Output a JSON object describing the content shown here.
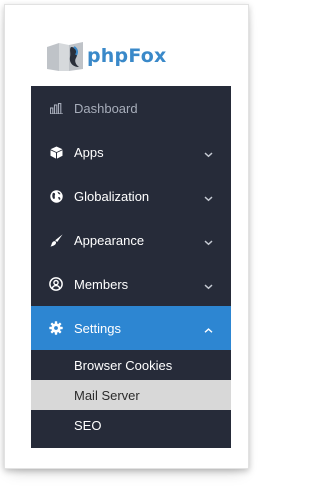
{
  "brand": {
    "name": "phpFox",
    "logo_icon": "phpfox-logo-icon"
  },
  "colors": {
    "sidebar_bg": "#262b39",
    "active_bg": "#2d86d2",
    "highlight_bg": "#d8d8d8",
    "brand_blue": "#3a89c9"
  },
  "menu": {
    "dashboard": {
      "label": "Dashboard",
      "icon": "bar-chart-icon"
    },
    "apps": {
      "label": "Apps",
      "icon": "cube-icon"
    },
    "globalization": {
      "label": "Globalization",
      "icon": "globe-icon"
    },
    "appearance": {
      "label": "Appearance",
      "icon": "paint-brush-icon"
    },
    "members": {
      "label": "Members",
      "icon": "user-circle-icon"
    },
    "settings": {
      "label": "Settings",
      "icon": "gear-icon"
    }
  },
  "settings_submenu": [
    {
      "label": "Browser Cookies"
    },
    {
      "label": "Mail Server"
    },
    {
      "label": "SEO"
    }
  ]
}
